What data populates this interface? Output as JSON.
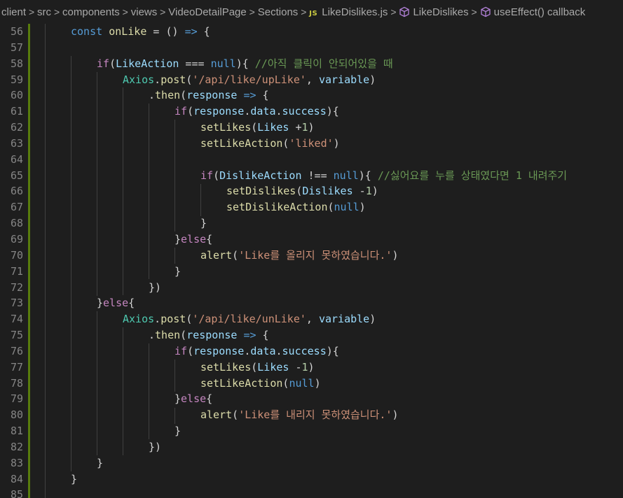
{
  "breadcrumb": {
    "items": [
      "client",
      "src",
      "components",
      "views",
      "VideoDetailPage",
      "Sections",
      "LikeDislikes.js",
      "LikeDislikes",
      "useEffect() callback"
    ],
    "js_badge": "JS",
    "separator": ">"
  },
  "colors": {
    "background": "#1e1e1e",
    "keyword": "#569cd6",
    "control": "#c586c0",
    "function": "#dcdcaa",
    "variable": "#9cdcfe",
    "class": "#4ec9b0",
    "string": "#ce9178",
    "number": "#b5cea8",
    "comment": "#6a9955",
    "git_added": "#587c0c"
  },
  "editor": {
    "line_numbers": [
      "56",
      "57",
      "58",
      "59",
      "60",
      "61",
      "62",
      "63",
      "64",
      "65",
      "66",
      "67",
      "68",
      "69",
      "70",
      "71",
      "72",
      "73",
      "74",
      "75",
      "76",
      "77",
      "78",
      "79",
      "80",
      "81",
      "82",
      "83",
      "84",
      "85"
    ],
    "lines": [
      [
        [
          "kw",
          "const "
        ],
        [
          "fn",
          "onLike"
        ],
        [
          "pun",
          " = () "
        ],
        [
          "kw",
          "=>"
        ],
        [
          "pun",
          " {"
        ]
      ],
      [],
      [
        [
          "ctl",
          "if"
        ],
        [
          "pun",
          "("
        ],
        [
          "var",
          "LikeAction"
        ],
        [
          "pun",
          " === "
        ],
        [
          "kw",
          "null"
        ],
        [
          "pun",
          "){ "
        ],
        [
          "cmt",
          "//아직 클릭이 안되어있을 때"
        ]
      ],
      [
        [
          "cls",
          "Axios"
        ],
        [
          "pun",
          "."
        ],
        [
          "fn",
          "post"
        ],
        [
          "pun",
          "("
        ],
        [
          "str",
          "'/api/like/upLike'"
        ],
        [
          "pun",
          ", "
        ],
        [
          "var",
          "variable"
        ],
        [
          "pun",
          ")"
        ]
      ],
      [
        [
          "pun",
          "."
        ],
        [
          "fn",
          "then"
        ],
        [
          "pun",
          "("
        ],
        [
          "var",
          "response"
        ],
        [
          "pun",
          " "
        ],
        [
          "kw",
          "=>"
        ],
        [
          "pun",
          " {"
        ]
      ],
      [
        [
          "ctl",
          "if"
        ],
        [
          "pun",
          "("
        ],
        [
          "var",
          "response"
        ],
        [
          "pun",
          "."
        ],
        [
          "var",
          "data"
        ],
        [
          "pun",
          "."
        ],
        [
          "var",
          "success"
        ],
        [
          "pun",
          "){"
        ]
      ],
      [
        [
          "fn",
          "setLikes"
        ],
        [
          "pun",
          "("
        ],
        [
          "var",
          "Likes"
        ],
        [
          "pun",
          " +"
        ],
        [
          "num",
          "1"
        ],
        [
          "pun",
          ")"
        ]
      ],
      [
        [
          "fn",
          "setLikeAction"
        ],
        [
          "pun",
          "("
        ],
        [
          "str",
          "'liked'"
        ],
        [
          "pun",
          ")"
        ]
      ],
      [],
      [
        [
          "ctl",
          "if"
        ],
        [
          "pun",
          "("
        ],
        [
          "var",
          "DislikeAction"
        ],
        [
          "pun",
          " !== "
        ],
        [
          "kw",
          "null"
        ],
        [
          "pun",
          "){ "
        ],
        [
          "cmt",
          "//싫어요를 누를 상태였다면 1 내려주기"
        ]
      ],
      [
        [
          "fn",
          "setDislikes"
        ],
        [
          "pun",
          "("
        ],
        [
          "var",
          "Dislikes"
        ],
        [
          "pun",
          " -"
        ],
        [
          "num",
          "1"
        ],
        [
          "pun",
          ")"
        ]
      ],
      [
        [
          "fn",
          "setDislikeAction"
        ],
        [
          "pun",
          "("
        ],
        [
          "kw",
          "null"
        ],
        [
          "pun",
          ")"
        ]
      ],
      [
        [
          "pun",
          "}"
        ]
      ],
      [
        [
          "pun",
          "}"
        ],
        [
          "ctl",
          "else"
        ],
        [
          "pun",
          "{"
        ]
      ],
      [
        [
          "fn",
          "alert"
        ],
        [
          "pun",
          "("
        ],
        [
          "str",
          "'Like를 올리지 못하였습니다.'"
        ],
        [
          "pun",
          ")"
        ]
      ],
      [
        [
          "pun",
          "}"
        ]
      ],
      [
        [
          "pun",
          "})"
        ]
      ],
      [
        [
          "pun",
          "}"
        ],
        [
          "ctl",
          "else"
        ],
        [
          "pun",
          "{"
        ]
      ],
      [
        [
          "cls",
          "Axios"
        ],
        [
          "pun",
          "."
        ],
        [
          "fn",
          "post"
        ],
        [
          "pun",
          "("
        ],
        [
          "str",
          "'/api/like/unLike'"
        ],
        [
          "pun",
          ", "
        ],
        [
          "var",
          "variable"
        ],
        [
          "pun",
          ")"
        ]
      ],
      [
        [
          "pun",
          "."
        ],
        [
          "fn",
          "then"
        ],
        [
          "pun",
          "("
        ],
        [
          "var",
          "response"
        ],
        [
          "pun",
          " "
        ],
        [
          "kw",
          "=>"
        ],
        [
          "pun",
          " {"
        ]
      ],
      [
        [
          "ctl",
          "if"
        ],
        [
          "pun",
          "("
        ],
        [
          "var",
          "response"
        ],
        [
          "pun",
          "."
        ],
        [
          "var",
          "data"
        ],
        [
          "pun",
          "."
        ],
        [
          "var",
          "success"
        ],
        [
          "pun",
          "){"
        ]
      ],
      [
        [
          "fn",
          "setLikes"
        ],
        [
          "pun",
          "("
        ],
        [
          "var",
          "Likes"
        ],
        [
          "pun",
          " -"
        ],
        [
          "num",
          "1"
        ],
        [
          "pun",
          ")"
        ]
      ],
      [
        [
          "fn",
          "setLikeAction"
        ],
        [
          "pun",
          "("
        ],
        [
          "kw",
          "null"
        ],
        [
          "pun",
          ")"
        ]
      ],
      [
        [
          "pun",
          "}"
        ],
        [
          "ctl",
          "else"
        ],
        [
          "pun",
          "{"
        ]
      ],
      [
        [
          "fn",
          "alert"
        ],
        [
          "pun",
          "("
        ],
        [
          "str",
          "'Like를 내리지 못하였습니다.'"
        ],
        [
          "pun",
          ")"
        ]
      ],
      [
        [
          "pun",
          "}"
        ]
      ],
      [
        [
          "pun",
          "})"
        ]
      ],
      [
        [
          "pun",
          "}"
        ]
      ],
      [
        [
          "pun",
          "}"
        ]
      ],
      []
    ]
  }
}
